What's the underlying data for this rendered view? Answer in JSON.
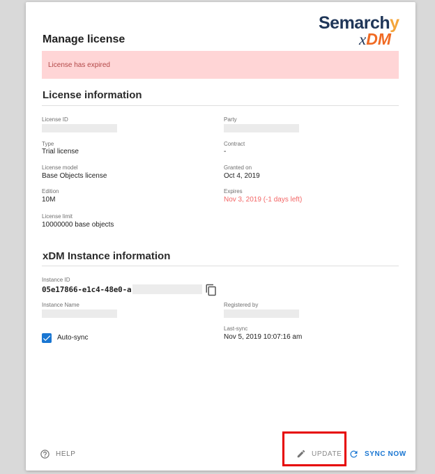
{
  "logo": {
    "brand": "Semarch",
    "brand_y": "y",
    "sub_x": "x",
    "sub_dm": "DM"
  },
  "page": {
    "title": "Manage license"
  },
  "alert": {
    "text": "License has expired"
  },
  "license_section": {
    "title": "License information",
    "license_id": {
      "label": "License ID",
      "value": ""
    },
    "party": {
      "label": "Party",
      "value": ""
    },
    "type": {
      "label": "Type",
      "value": "Trial license"
    },
    "contract": {
      "label": "Contract",
      "value": "-"
    },
    "license_model": {
      "label": "License model",
      "value": "Base Objects license"
    },
    "granted_on": {
      "label": "Granted on",
      "value": "Oct 4, 2019"
    },
    "edition": {
      "label": "Edition",
      "value": "10M"
    },
    "expires": {
      "label": "Expires",
      "value": "Nov 3, 2019 (-1 days left)",
      "color": "#f36565"
    },
    "license_limit": {
      "label": "License limit",
      "value": "10000000 base objects"
    }
  },
  "instance_section": {
    "title": "xDM Instance information",
    "instance_id": {
      "label": "Instance ID",
      "value": "05e17866-e1c4-48e0-a"
    },
    "instance_name": {
      "label": "Instance Name",
      "value": ""
    },
    "registered_by": {
      "label": "Registered by",
      "value": ""
    },
    "auto_sync": {
      "label": "Auto-sync",
      "checked": true
    },
    "last_sync": {
      "label": "Last-sync",
      "value": "Nov 5, 2019 10:07:16 am"
    }
  },
  "footer": {
    "help_label": "HELP",
    "update_label": "UPDATE",
    "sync_label": "SYNC NOW"
  },
  "colors": {
    "accent": "#1976d2",
    "alert_bg": "#ffd5d6",
    "alert_text": "#b24747",
    "highlight": "#e60000"
  }
}
